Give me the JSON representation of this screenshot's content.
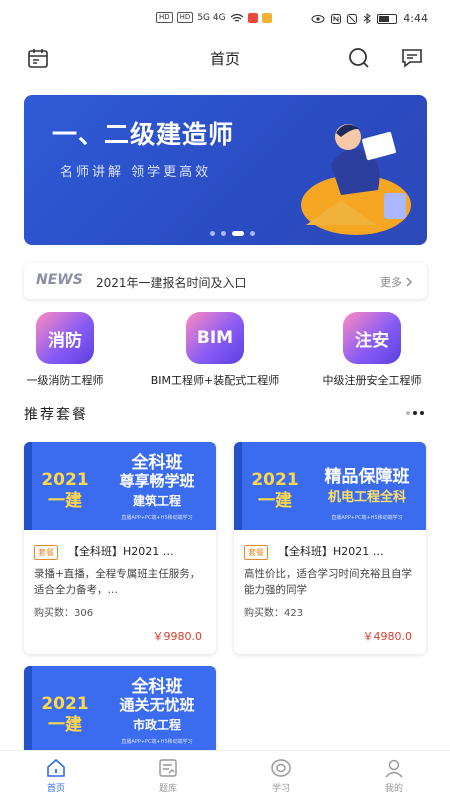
{
  "status": {
    "left_chips": [
      "HD",
      "HD"
    ],
    "signal": "5G 4G",
    "time": "4:44"
  },
  "topbar": {
    "title": "首页",
    "left_icon": "calendar-icon",
    "search_icon": "search-icon",
    "message_icon": "message-icon"
  },
  "banner": {
    "title": "一、二级建造师",
    "subtitle": "名师讲解   领学更高效"
  },
  "news": {
    "tag": "NEWS",
    "headline": "2021年一建报名时间及入口",
    "more": "更多"
  },
  "categories": [
    {
      "icon_text": "消防",
      "label": "一级消防工程师"
    },
    {
      "icon_text": "BIM",
      "label": "BIM工程师+装配式工程师"
    },
    {
      "icon_text": "注安",
      "label": "中级注册安全工程师"
    }
  ],
  "section": {
    "title": "推荐套餐"
  },
  "packages": [
    {
      "cover_year": "2021",
      "cover_exam": "一建",
      "cover_line1": "全科班",
      "cover_line2": "尊享畅学班",
      "cover_line3": "建筑工程",
      "cover_fine": "直播APP+PC端+H5移动端学习",
      "badge": "套餐",
      "name": "【全科班】H2021 …",
      "desc": "录播+直播，全程专属班主任服务，适合全力备考，…",
      "buy": "购买数：306",
      "price": "￥9980.0"
    },
    {
      "cover_year": "2021",
      "cover_exam": "一建",
      "cover_line1": "精品保障班",
      "cover_line2": "机电工程全科",
      "cover_line3": "",
      "cover_fine": "直播APP+PC端+H5移动端学习",
      "badge": "套餐",
      "name": "【全科班】H2021 …",
      "desc": "高性价比，适合学习时间充裕且自学能力强的同学",
      "buy": "购买数：423",
      "price": "￥4980.0"
    },
    {
      "cover_year": "2021",
      "cover_exam": "一建",
      "cover_line1": "全科班",
      "cover_line2": "通关无忧班",
      "cover_line3": "市政工程",
      "cover_fine": "直播APP+PC端+H5移动端学习"
    }
  ],
  "bottom_nav": [
    {
      "label": "首页",
      "icon": "home-icon"
    },
    {
      "label": "题库",
      "icon": "question-bank-icon"
    },
    {
      "label": "学习",
      "icon": "study-icon"
    },
    {
      "label": "我的",
      "icon": "profile-icon"
    }
  ],
  "colors": {
    "brand_blue": "#2f6cf0",
    "price_red": "#e03a2a",
    "badge_orange": "#e58a2b",
    "cover_year_yellow": "#ffd84a"
  }
}
